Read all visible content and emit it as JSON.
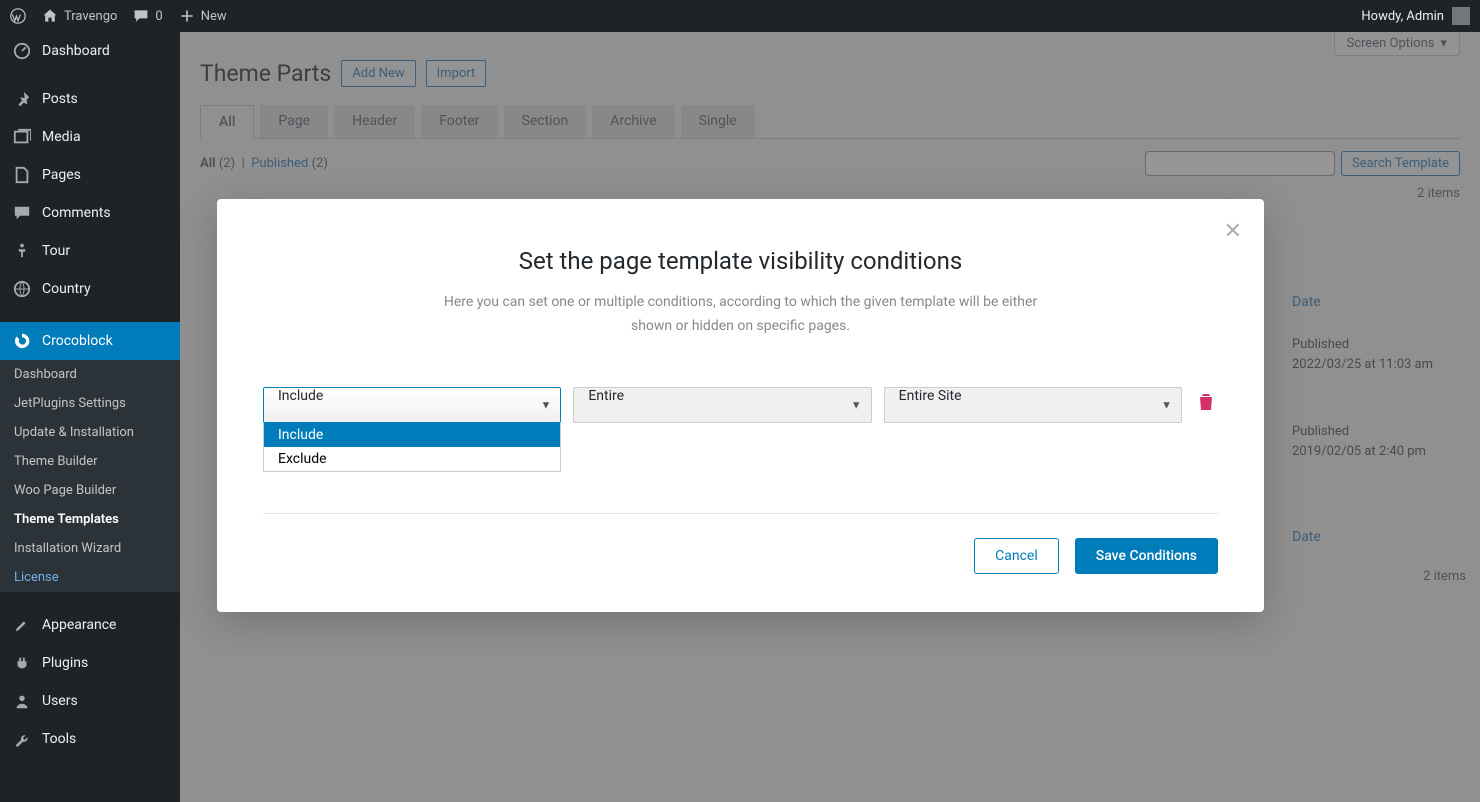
{
  "adminbar": {
    "site": "Travengo",
    "comments": "0",
    "new": "New",
    "howdy": "Howdy, Admin"
  },
  "sidebar": {
    "dashboard": "Dashboard",
    "posts": "Posts",
    "media": "Media",
    "pages": "Pages",
    "comments": "Comments",
    "tour": "Tour",
    "country": "Country",
    "crocoblock": "Crocoblock",
    "sub_dashboard": "Dashboard",
    "sub_jetplugins": "JetPlugins Settings",
    "sub_update": "Update & Installation",
    "sub_themebuilder": "Theme Builder",
    "sub_woopage": "Woo Page Builder",
    "sub_themetemplates": "Theme Templates",
    "sub_installwiz": "Installation Wizard",
    "sub_license": "License",
    "appearance": "Appearance",
    "plugins": "Plugins",
    "users": "Users",
    "tools": "Tools"
  },
  "page": {
    "screen_options": "Screen Options",
    "title": "Theme Parts",
    "addnew": "Add New",
    "import": "Import"
  },
  "tabs": {
    "all": "All",
    "page": "Page",
    "header": "Header",
    "footer": "Footer",
    "section": "Section",
    "archive": "Archive",
    "single": "Single"
  },
  "status": {
    "all_label": "All",
    "all_count": "(2)",
    "pub_label": "Published",
    "pub_count": "(2)",
    "search_btn": "Search Template",
    "items": "2 items",
    "date": "Date"
  },
  "rows": {
    "r1_status": "Published",
    "r1_date": "2022/03/25 at 11:03 am",
    "r2_status": "Published",
    "r2_date": "2019/02/05 at 2:40 pm"
  },
  "modal": {
    "title": "Set the page template visibility conditions",
    "desc": "Here you can set one or multiple conditions, according to which the given template will be either shown or hidden on specific pages.",
    "s1_value": "Include",
    "s1_opt1": "Include",
    "s1_opt2": "Exclude",
    "s2_value": "Entire",
    "s3_value": "Entire Site",
    "cancel": "Cancel",
    "save": "Save Conditions"
  }
}
